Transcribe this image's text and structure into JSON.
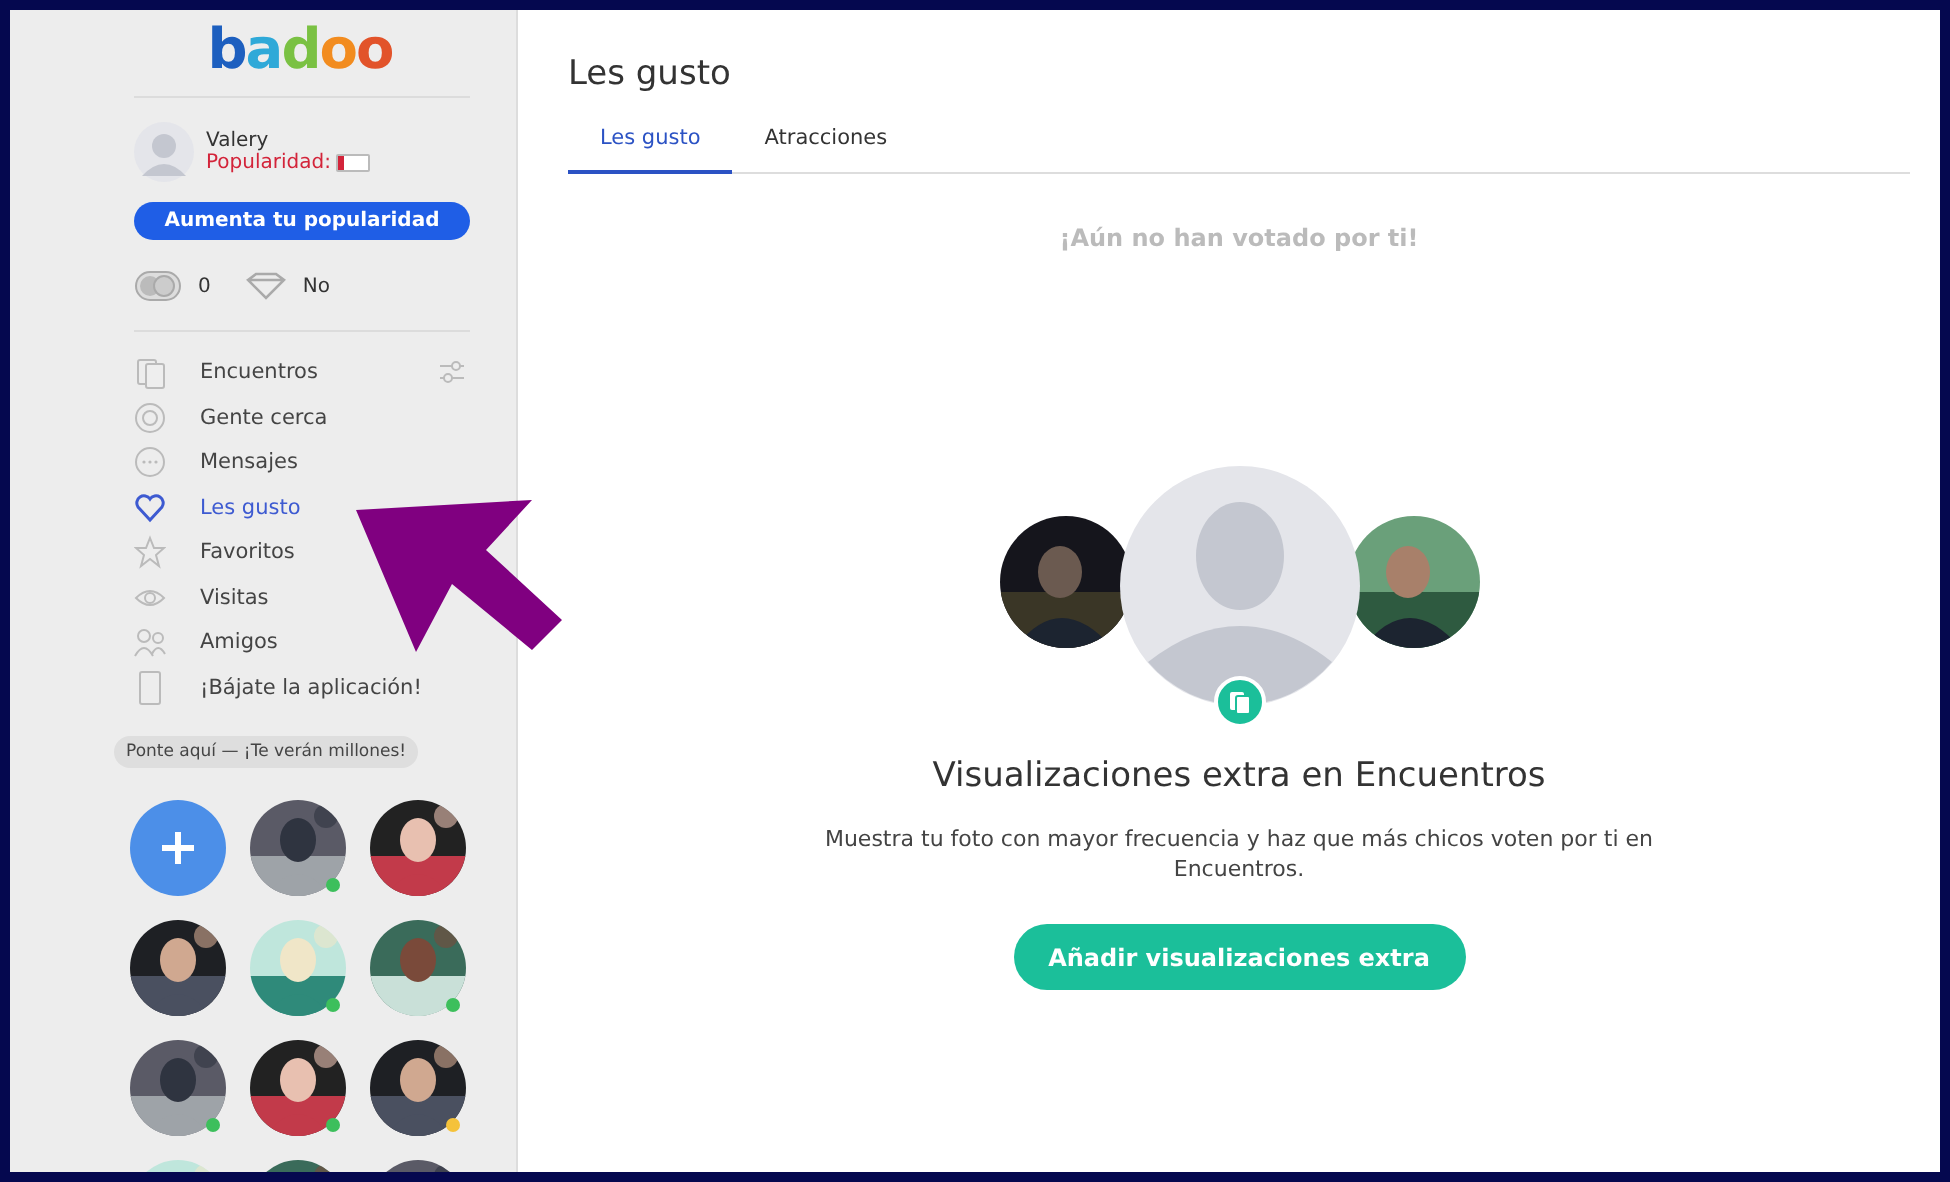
{
  "sidebar": {
    "logo": "badoo",
    "profile": {
      "name": "Valery",
      "popularity_label": "Popularidad:",
      "popularity": {
        "level": 0.15
      }
    },
    "boost_button": "Aumenta tu popularidad",
    "stats": [
      {
        "kind": "credits",
        "value": "0"
      },
      {
        "kind": "premium",
        "value": "No"
      }
    ],
    "items": [
      {
        "kind": "cards",
        "label": "Encuentros",
        "selected": false,
        "settings": true
      },
      {
        "kind": "target",
        "label": "Gente cerca",
        "selected": false,
        "settings": false
      },
      {
        "kind": "chat",
        "label": "Mensajes",
        "selected": false,
        "settings": false
      },
      {
        "kind": "heart",
        "label": "Les gusto",
        "selected": true,
        "settings": false
      },
      {
        "kind": "star",
        "label": "Favoritos",
        "selected": false,
        "settings": false
      },
      {
        "kind": "eye",
        "label": "Visitas",
        "selected": false,
        "settings": false
      },
      {
        "kind": "people",
        "label": "Amigos",
        "selected": false,
        "settings": false
      },
      {
        "kind": "phone",
        "label": "¡Bájate la aplicación!",
        "selected": false,
        "settings": false
      }
    ],
    "spotlight_hint": "Ponte aquí — ¡Te verán millones!",
    "spotlight": [
      {
        "kind": "add"
      },
      {
        "kind": "picture",
        "color": "#3dbf5c"
      },
      {
        "kind": "picture"
      },
      {
        "kind": "picture"
      },
      {
        "kind": "picture",
        "color": "#3dbf5c"
      },
      {
        "kind": "picture",
        "color": "#3dbf5c"
      },
      {
        "kind": "picture",
        "color": "#3dbf5c"
      },
      {
        "kind": "picture",
        "color": "#3dbf5c"
      },
      {
        "kind": "picture",
        "color": "#f5c23a"
      },
      {
        "kind": "picture"
      },
      {
        "kind": "picture"
      },
      {
        "kind": "picture"
      }
    ]
  },
  "main": {
    "title": "Les gusto",
    "tabs": [
      {
        "label": "Les gusto",
        "selected": true
      },
      {
        "label": "Atracciones",
        "selected": false
      }
    ],
    "empty_message": "¡Aún no han votado por ti!",
    "promo": {
      "heading": "Visualizaciones extra en Encuentros",
      "text": "Muestra tu foto con mayor frecuencia y haz que más chicos voten por ti en Encuentros.",
      "button": "Añadir visualizaciones extra"
    }
  },
  "annotation": {
    "kind": "arrow"
  }
}
